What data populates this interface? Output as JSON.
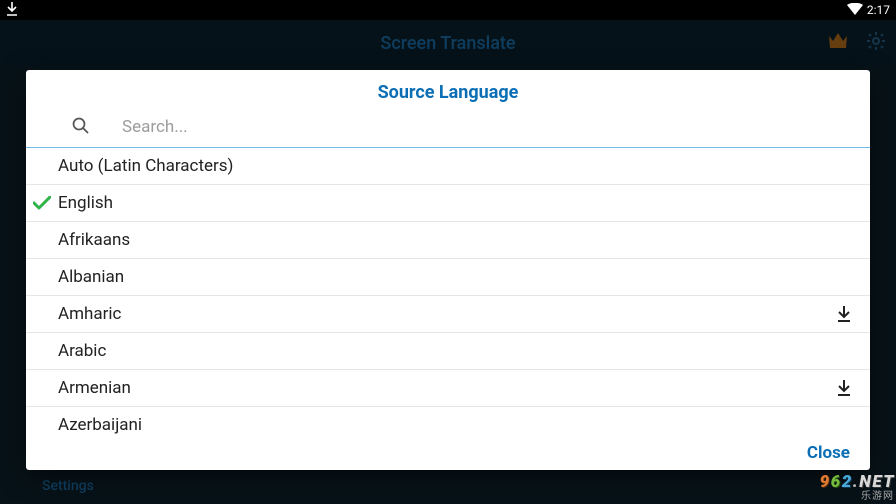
{
  "status_bar": {
    "time": "2:17"
  },
  "app": {
    "title": "Screen Translate",
    "settings_label": "Settings"
  },
  "dialog": {
    "title": "Source Language",
    "search_placeholder": "Search...",
    "close_label": "Close",
    "languages": [
      {
        "label": "Auto (Latin Characters)",
        "selected": false,
        "downloadable": false
      },
      {
        "label": "English",
        "selected": true,
        "downloadable": false
      },
      {
        "label": "Afrikaans",
        "selected": false,
        "downloadable": false
      },
      {
        "label": "Albanian",
        "selected": false,
        "downloadable": false
      },
      {
        "label": "Amharic",
        "selected": false,
        "downloadable": true
      },
      {
        "label": "Arabic",
        "selected": false,
        "downloadable": false
      },
      {
        "label": "Armenian",
        "selected": false,
        "downloadable": true
      },
      {
        "label": "Azerbaijani",
        "selected": false,
        "downloadable": false
      }
    ]
  },
  "watermark": {
    "domain": "962.NET",
    "sub": "乐游网"
  }
}
